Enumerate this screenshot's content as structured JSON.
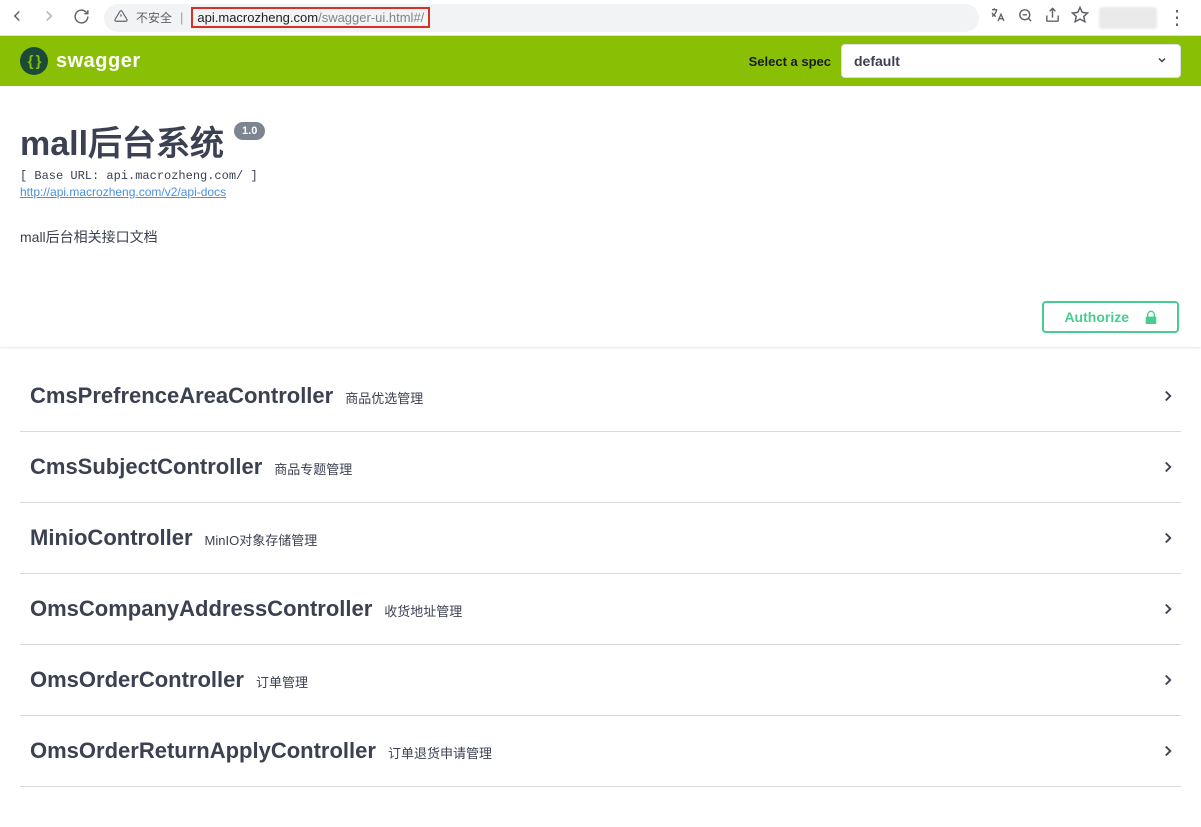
{
  "browser": {
    "insecure_label": "不安全",
    "url_host": "api.macrozheng.com",
    "url_path": "/swagger-ui.html#/"
  },
  "topbar": {
    "brand": "swagger",
    "select_label": "Select a spec",
    "select_value": "default"
  },
  "info": {
    "title": "mall后台系统",
    "version": "1.0",
    "base_url": "[ Base URL: api.macrozheng.com/ ]",
    "api_link": "http://api.macrozheng.com/v2/api-docs",
    "description": "mall后台相关接口文档"
  },
  "authorize": {
    "label": "Authorize"
  },
  "tags": [
    {
      "name": "CmsPrefrenceAreaController",
      "desc": "商品优选管理"
    },
    {
      "name": "CmsSubjectController",
      "desc": "商品专题管理"
    },
    {
      "name": "MinioController",
      "desc": "MinIO对象存储管理"
    },
    {
      "name": "OmsCompanyAddressController",
      "desc": "收货地址管理"
    },
    {
      "name": "OmsOrderController",
      "desc": "订单管理"
    },
    {
      "name": "OmsOrderReturnApplyController",
      "desc": "订单退货申请管理"
    }
  ]
}
